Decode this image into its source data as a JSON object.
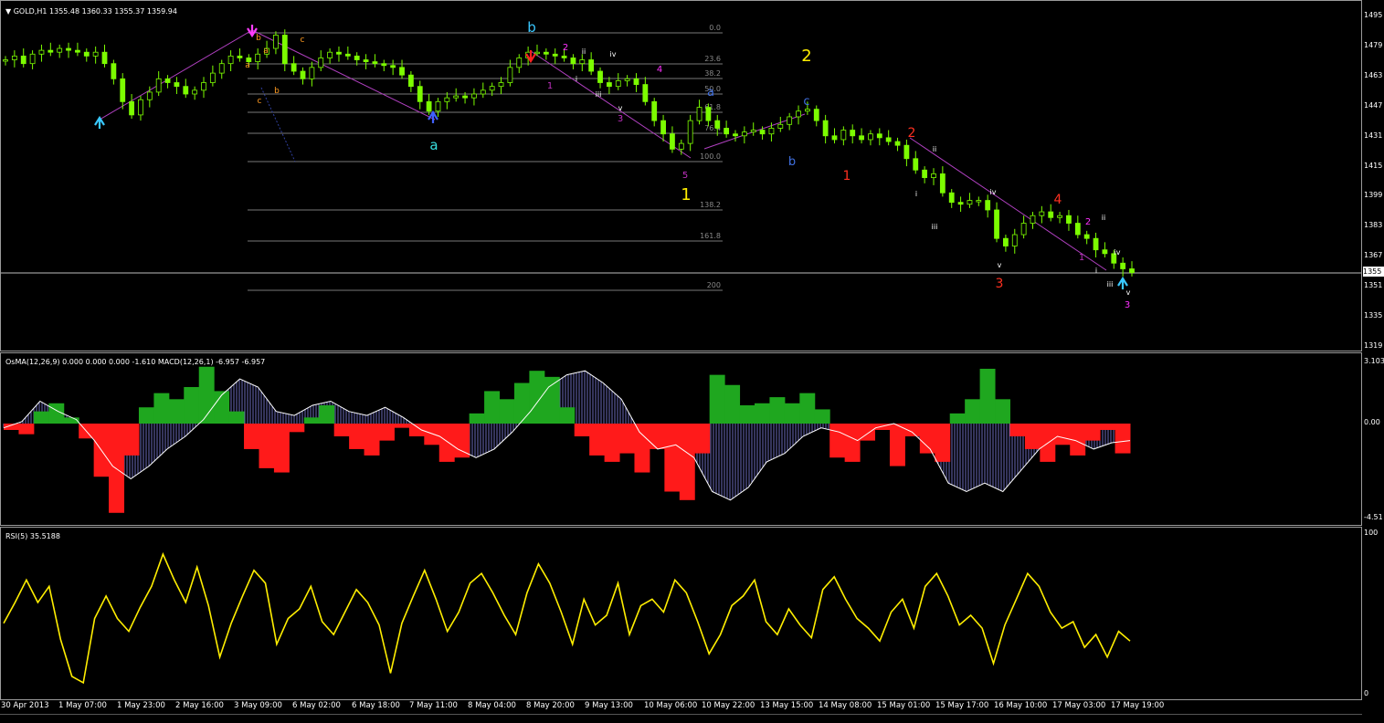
{
  "header": {
    "symbol_label": "GOLD,H1",
    "ohlc": "1355.48 1360.33 1355.37 1359.94",
    "osma_label": "OsMA(12,26,9) 0.000 0.000 0.000 -1.610",
    "macd_label": "MACD(12,26,1) -6.957 -6.957",
    "rsi_label": "RSI(5) 35.5188"
  },
  "price_axis": [
    "1495",
    "1479",
    "1463",
    "1447",
    "1431",
    "1415",
    "1399",
    "1383",
    "1367",
    "1351",
    "1335",
    "1319"
  ],
  "current_price": "1355",
  "macd_axis": [
    "3.103",
    "0.00",
    "-4.51"
  ],
  "rsi_axis": [
    "100",
    "0"
  ],
  "time_axis": [
    "30 Apr 2013",
    "1 May 07:00",
    "1 May 23:00",
    "2 May 16:00",
    "3 May 09:00",
    "6 May 02:00",
    "6 May 18:00",
    "7 May 11:00",
    "8 May 04:00",
    "8 May 20:00",
    "9 May 13:00",
    "10 May 06:00",
    "10 May 22:00",
    "13 May 15:00",
    "14 May 08:00",
    "15 May 01:00",
    "15 May 17:00",
    "16 May 10:00",
    "17 May 03:00",
    "17 May 19:00"
  ],
  "fib_levels": [
    "0.0",
    "23.6",
    "38.2",
    "50.0",
    "61.8",
    "76.4",
    "100.0",
    "138.2",
    "161.8",
    "200"
  ],
  "wave_labels": {
    "big_1": "1",
    "big_2": "2",
    "a": "a",
    "b": "b",
    "c": "c",
    "r1": "1",
    "r2": "2",
    "r3": "3",
    "r4": "4",
    "m1": "1",
    "m2": "2",
    "m3": "3",
    "m4": "4",
    "m5": "5",
    "i": "i",
    "ii": "ii",
    "iii": "iii",
    "iv": "iv",
    "v": "v"
  },
  "colors": {
    "candle": "#7cfc00",
    "macd_pos": "#1fa71f",
    "macd_neg": "#ff1a1a",
    "macd_line": "#ffffff",
    "rsi": "#ffee00",
    "wave_line": "#b040c0",
    "fib": "#777777"
  },
  "chart_data": [
    {
      "type": "candlestick",
      "title": "GOLD,H1",
      "ylim": [
        1319,
        1503
      ],
      "close_path": [
        1472,
        1474,
        1470,
        1475,
        1477,
        1476,
        1478,
        1477,
        1476,
        1474,
        1476,
        1470,
        1462,
        1450,
        1443,
        1451,
        1455,
        1462,
        1460,
        1458,
        1454,
        1456,
        1460,
        1465,
        1470,
        1474,
        1473,
        1471,
        1475,
        1478,
        1485,
        1470,
        1466,
        1462,
        1468,
        1473,
        1476,
        1475,
        1474,
        1472,
        1471,
        1470,
        1469,
        1468,
        1464,
        1458,
        1450,
        1445,
        1450,
        1452,
        1453,
        1452,
        1454,
        1456,
        1458,
        1460,
        1468,
        1473,
        1476,
        1476,
        1475,
        1474,
        1473,
        1470,
        1472,
        1466,
        1460,
        1458,
        1461,
        1462,
        1459,
        1450,
        1440,
        1433,
        1425,
        1428,
        1440,
        1447,
        1440,
        1436,
        1433,
        1432,
        1434,
        1435,
        1433,
        1436,
        1438,
        1442,
        1445,
        1446,
        1440,
        1432,
        1430,
        1435,
        1432,
        1430,
        1433,
        1431,
        1429,
        1427,
        1420,
        1414,
        1410,
        1412,
        1402,
        1397,
        1396,
        1398,
        1398,
        1393,
        1378,
        1374,
        1380,
        1386,
        1390,
        1392,
        1389,
        1390,
        1386,
        1380,
        1378,
        1372,
        1370,
        1365,
        1362,
        1360
      ]
    },
    {
      "type": "bar",
      "title": "OsMA(12,26,9)",
      "ylim": [
        -4.51,
        3.103
      ],
      "histogram": [
        -0.3,
        -0.5,
        0.6,
        1.0,
        0.3,
        -0.7,
        -2.5,
        -4.2,
        -1.5,
        0.8,
        1.5,
        1.2,
        1.8,
        2.8,
        1.6,
        0.6,
        -1.2,
        -2.1,
        -2.3,
        -0.4,
        0.3,
        0.9,
        -0.6,
        -1.2,
        -1.5,
        -0.8,
        -0.2,
        -0.6,
        -1.0,
        -1.8,
        -1.6,
        0.5,
        1.6,
        1.2,
        2.0,
        2.6,
        2.3,
        0.8,
        -0.6,
        -1.5,
        -1.8,
        -1.4,
        -2.3,
        -1.2,
        -3.2,
        -3.6,
        -1.4,
        2.4,
        1.9,
        0.9,
        1.0,
        1.3,
        1.0,
        1.5,
        0.7,
        -1.6,
        -1.8,
        -0.8,
        -0.3,
        -2.0,
        -0.6,
        -1.4,
        -1.8,
        0.5,
        1.2,
        2.7,
        1.2,
        -0.6,
        -1.2,
        -1.8,
        -1.0,
        -1.5,
        -0.8,
        -0.3,
        -1.4
      ],
      "macd_line": [
        -0.2,
        0.1,
        1.1,
        0.6,
        0.2,
        -0.8,
        -2.0,
        -2.6,
        -2.0,
        -1.2,
        -0.6,
        0.2,
        1.4,
        2.2,
        1.8,
        0.6,
        0.4,
        0.9,
        1.1,
        0.6,
        0.4,
        0.8,
        0.3,
        -0.3,
        -0.6,
        -1.2,
        -1.6,
        -1.2,
        -0.4,
        0.6,
        1.8,
        2.4,
        2.6,
        2.0,
        1.2,
        -0.4,
        -1.2,
        -1.0,
        -1.6,
        -3.2,
        -3.6,
        -3.0,
        -1.8,
        -1.4,
        -0.6,
        -0.2,
        -0.4,
        -0.8,
        -0.2,
        0.0,
        -0.4,
        -1.2,
        -2.8,
        -3.2,
        -2.8,
        -3.2,
        -2.2,
        -1.2,
        -0.6,
        -0.8,
        -1.2,
        -0.9,
        -0.8
      ]
    },
    {
      "type": "line",
      "title": "RSI(5)",
      "ylim": [
        0,
        100
      ],
      "values": [
        45,
        58,
        72,
        58,
        68,
        35,
        12,
        8,
        48,
        62,
        48,
        40,
        55,
        68,
        88,
        72,
        58,
        80,
        56,
        24,
        45,
        62,
        78,
        70,
        32,
        48,
        54,
        68,
        46,
        38,
        52,
        66,
        58,
        44,
        14,
        45,
        62,
        78,
        60,
        40,
        52,
        70,
        76,
        64,
        50,
        38,
        64,
        82,
        70,
        52,
        32,
        60,
        44,
        50,
        70,
        38,
        56,
        60,
        52,
        72,
        64,
        46,
        26,
        38,
        56,
        62,
        72,
        46,
        38,
        54,
        44,
        36,
        66,
        74,
        60,
        48,
        42,
        34,
        52,
        60,
        42,
        68,
        76,
        62,
        44,
        50,
        42,
        20,
        44,
        60,
        76,
        68,
        52,
        42,
        46,
        30,
        38,
        24,
        40,
        34
      ]
    }
  ]
}
